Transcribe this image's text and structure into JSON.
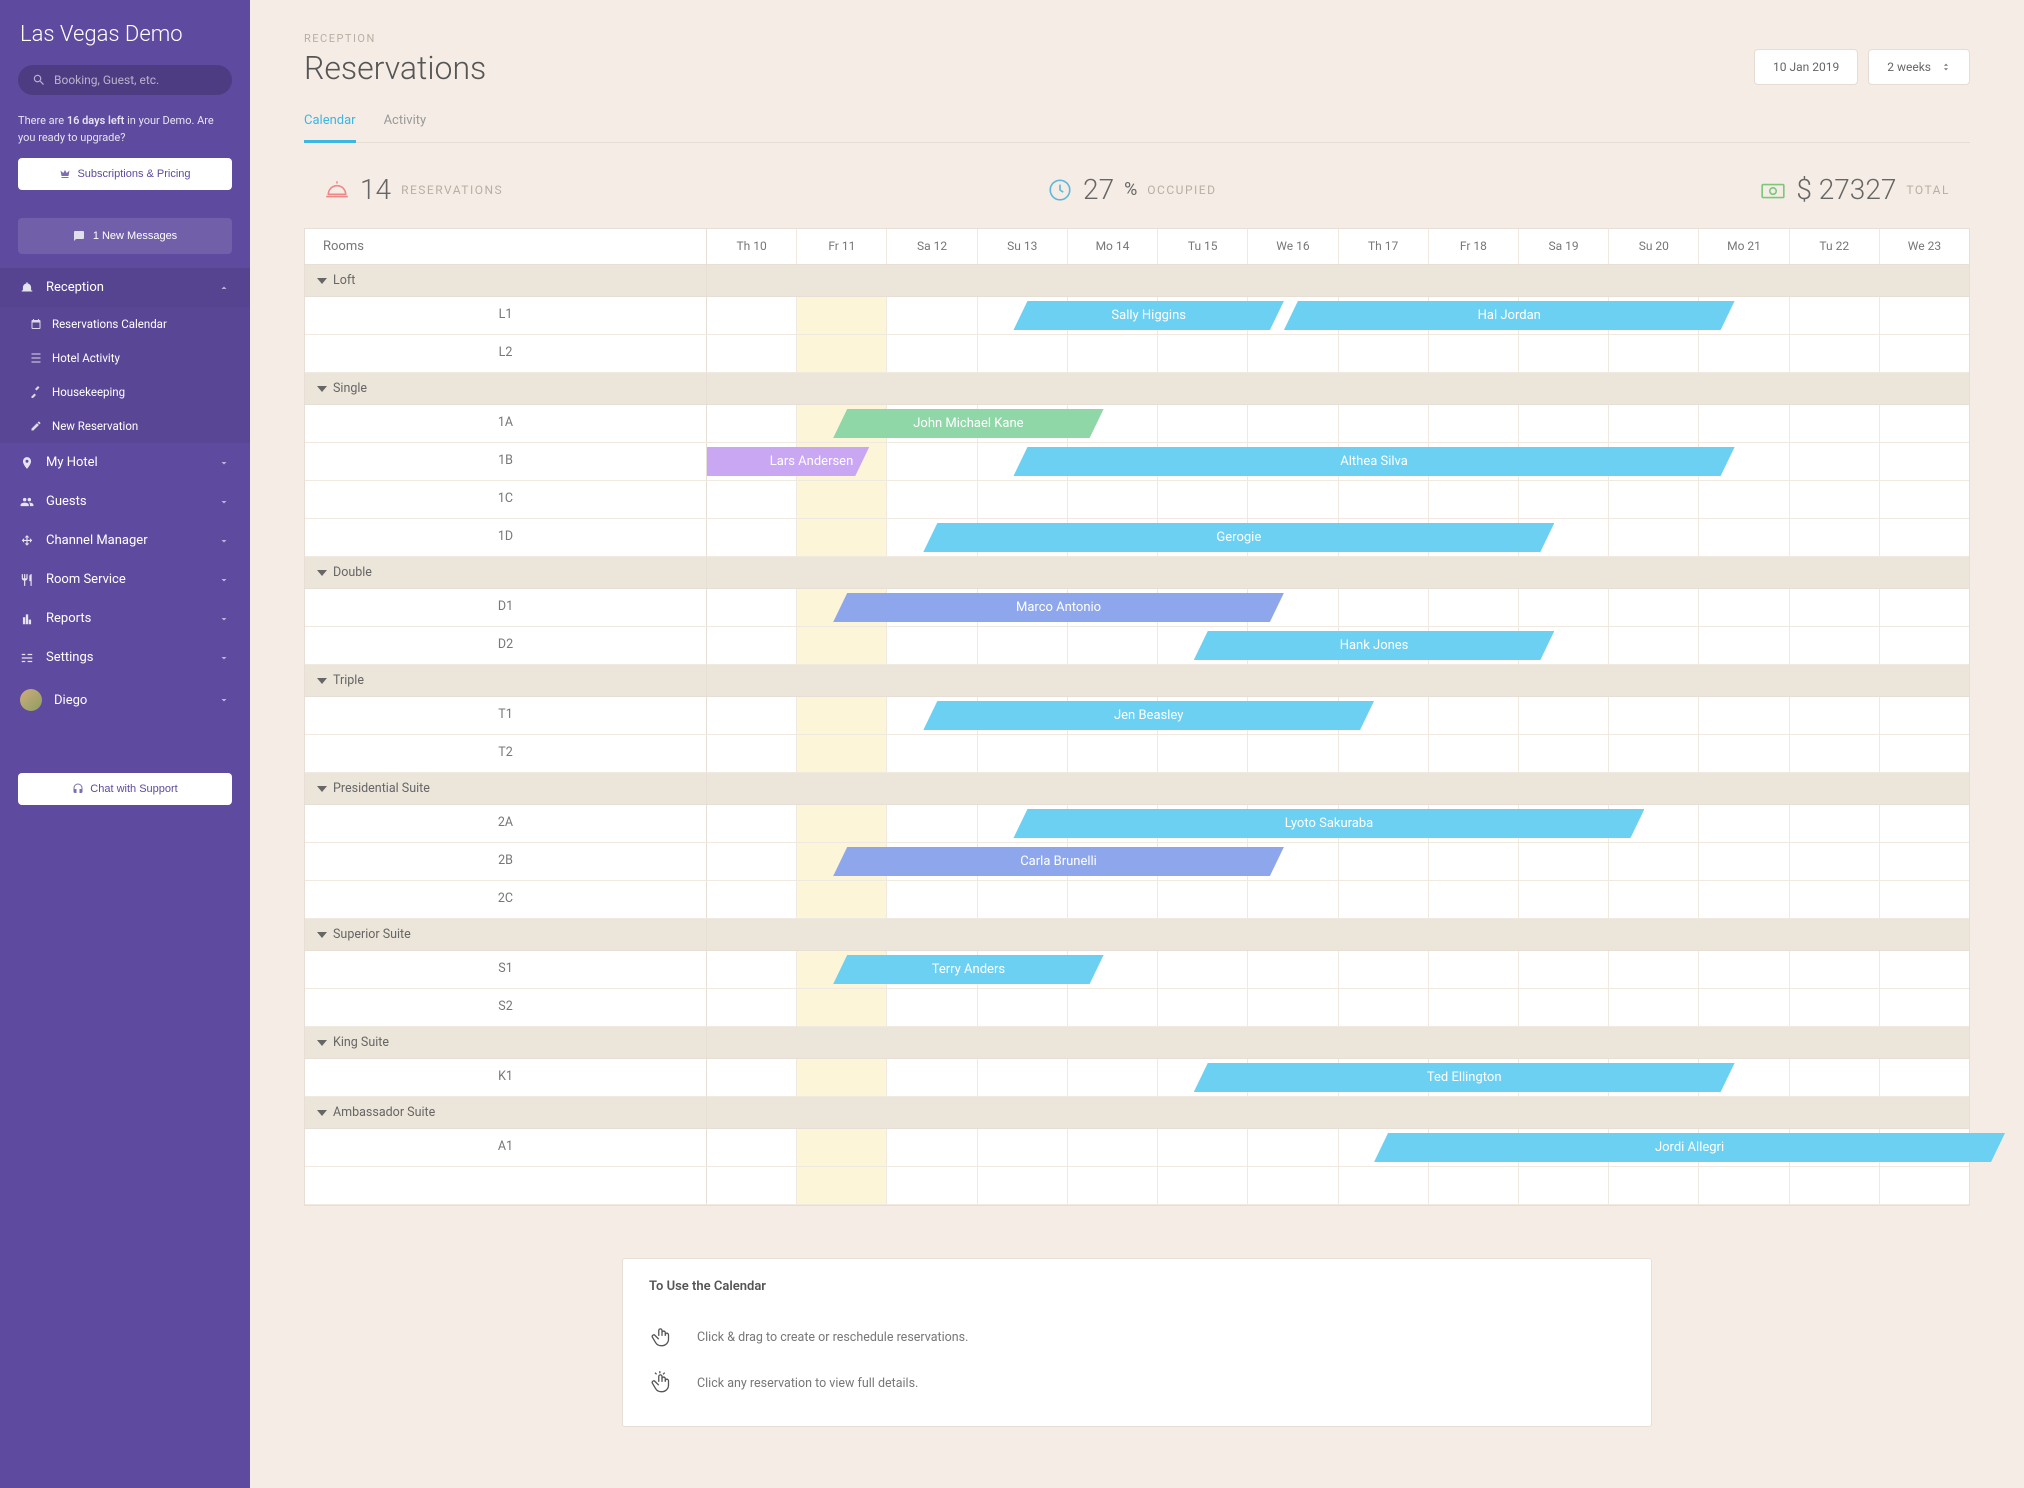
{
  "brand": "Las Vegas Demo",
  "search_placeholder": "Booking, Guest, etc.",
  "demo_note_pre": "There are ",
  "demo_note_bold": "16 days left",
  "demo_note_post": " in your Demo. Are you ready to upgrade?",
  "btn_subscriptions": "Subscriptions & Pricing",
  "btn_messages": "1 New Messages",
  "btn_chat": "Chat with Support",
  "nav": {
    "reception": "Reception",
    "reservations_calendar": "Reservations Calendar",
    "hotel_activity": "Hotel Activity",
    "housekeeping": "Housekeeping",
    "new_reservation": "New Reservation",
    "my_hotel": "My Hotel",
    "guests": "Guests",
    "channel_manager": "Channel Manager",
    "room_service": "Room Service",
    "reports": "Reports",
    "settings": "Settings",
    "user": "Diego"
  },
  "crumb": "RECEPTION",
  "title": "Reservations",
  "date_picker": "10 Jan 2019",
  "range_picker": "2 weeks",
  "tabs": {
    "calendar": "Calendar",
    "activity": "Activity"
  },
  "stats": {
    "reservations_count": "14",
    "reservations_label": "RESERVATIONS",
    "occupied_count": "27",
    "occupied_pct": "%",
    "occupied_label": "OCCUPIED",
    "total_num": "$ 27327",
    "total_label": "TOTAL"
  },
  "rooms_header": "Rooms",
  "days": [
    "Th 10",
    "Fr 11",
    "Sa 12",
    "Su 13",
    "Mo 14",
    "Tu 15",
    "We 16",
    "Th 17",
    "Fr 18",
    "Sa 19",
    "Su 20",
    "Mo 21",
    "Tu 22",
    "We 23"
  ],
  "today_index": 1,
  "groups": [
    {
      "name": "Loft",
      "rooms": [
        "L1",
        "L2"
      ]
    },
    {
      "name": "Single",
      "rooms": [
        "1A",
        "1B",
        "1C",
        "1D"
      ]
    },
    {
      "name": "Double",
      "rooms": [
        "D1",
        "D2"
      ]
    },
    {
      "name": "Triple",
      "rooms": [
        "T1",
        "T2"
      ]
    },
    {
      "name": "Presidential Suite",
      "rooms": [
        "2A",
        "2B",
        "2C"
      ]
    },
    {
      "name": "Superior Suite",
      "rooms": [
        "S1",
        "S2"
      ]
    },
    {
      "name": "King Suite",
      "rooms": [
        "K1"
      ]
    },
    {
      "name": "Ambassador Suite",
      "rooms": [
        "A1"
      ]
    }
  ],
  "bookings": [
    {
      "room": "L1",
      "guest": "Sally Higgins",
      "start": 3,
      "span": 3,
      "color": "#6cd0f2"
    },
    {
      "room": "L1",
      "guest": "Hal Jordan",
      "start": 6,
      "span": 5,
      "color": "#6cd0f2"
    },
    {
      "room": "1A",
      "guest": "John Michael Kane",
      "start": 1,
      "span": 3,
      "color": "#8fd7a6"
    },
    {
      "room": "1B",
      "guest": "Lars Andersen",
      "start": 0,
      "span": 1.4,
      "color": "#c9a7f2",
      "truncated": true
    },
    {
      "room": "1B",
      "guest": "Althea Silva",
      "start": 3,
      "span": 8,
      "color": "#6cd0f2"
    },
    {
      "room": "1D",
      "guest": "Gerogie",
      "start": 2,
      "span": 7,
      "color": "#6cd0f2"
    },
    {
      "room": "D1",
      "guest": "Marco Antonio",
      "start": 1,
      "span": 5,
      "color": "#8ea7ec"
    },
    {
      "room": "D2",
      "guest": "Hank Jones",
      "start": 5,
      "span": 4,
      "color": "#6cd0f2"
    },
    {
      "room": "T1",
      "guest": "Jen Beasley",
      "start": 2,
      "span": 5,
      "color": "#6cd0f2"
    },
    {
      "room": "2A",
      "guest": "Lyoto Sakuraba",
      "start": 3,
      "span": 7,
      "color": "#6cd0f2"
    },
    {
      "room": "2B",
      "guest": "Carla Brunelli",
      "start": 1,
      "span": 5,
      "color": "#8ea7ec"
    },
    {
      "room": "S1",
      "guest": "Terry Anders",
      "start": 1,
      "span": 3,
      "color": "#6cd0f2"
    },
    {
      "room": "K1",
      "guest": "Ted Ellington",
      "start": 5,
      "span": 6,
      "color": "#6cd0f2"
    },
    {
      "room": "A1",
      "guest": "Jordi Allegri",
      "start": 7,
      "span": 7,
      "color": "#6cd0f2"
    }
  ],
  "help": {
    "title": "To Use the Calendar",
    "line1": "Click & drag to create or reschedule reservations.",
    "line2": "Click any reservation to view full details."
  }
}
